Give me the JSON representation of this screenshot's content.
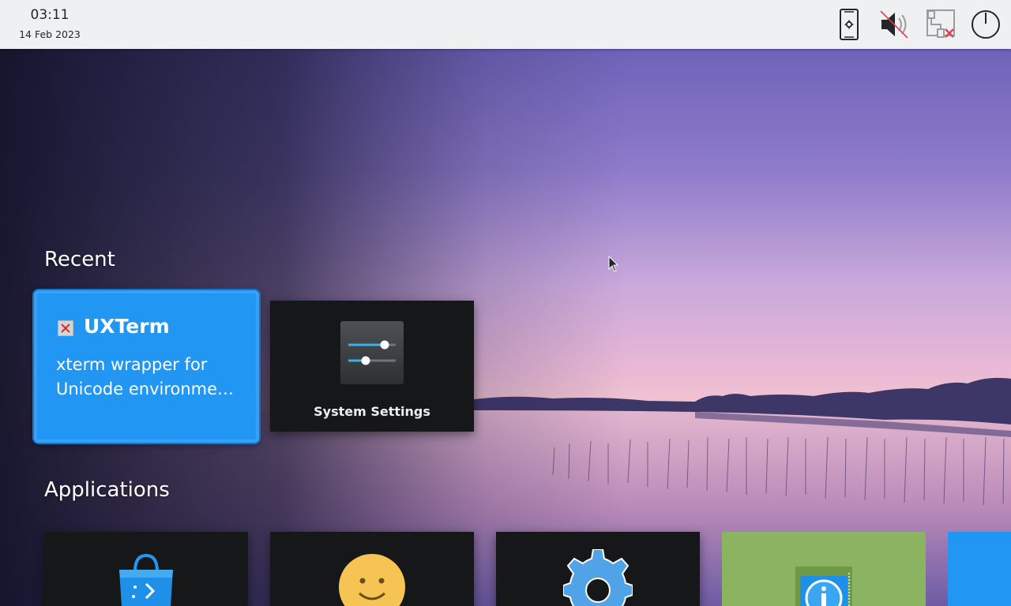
{
  "panel": {
    "time": "03:11",
    "date": "14 Feb 2023",
    "tray_icons": [
      "phone-settings-icon",
      "speaker-muted-icon",
      "network-disconnected-icon",
      "power-icon"
    ]
  },
  "recent": {
    "heading": "Recent",
    "items": [
      {
        "title": "UXTerm",
        "description_line1": "xterm wrapper for",
        "description_line2": "Unicode environme…",
        "icon": "xterm-icon",
        "selected": true
      },
      {
        "title": "System Settings",
        "icon": "settings-sliders-icon"
      }
    ]
  },
  "applications": {
    "heading": "Applications",
    "items": [
      {
        "icon": "store-bag-icon",
        "bg": "#161718"
      },
      {
        "icon": "smiley-icon",
        "bg": "#161718"
      },
      {
        "icon": "gear-icon",
        "bg": "#161718"
      },
      {
        "icon": "info-icon",
        "bg": "#8cb35f"
      },
      {
        "icon": "blue-app-icon",
        "bg": "#2196f3"
      }
    ]
  },
  "colors": {
    "accent": "#2196f3",
    "panel_bg": "#eff0f1",
    "tile_dark": "#161718"
  }
}
